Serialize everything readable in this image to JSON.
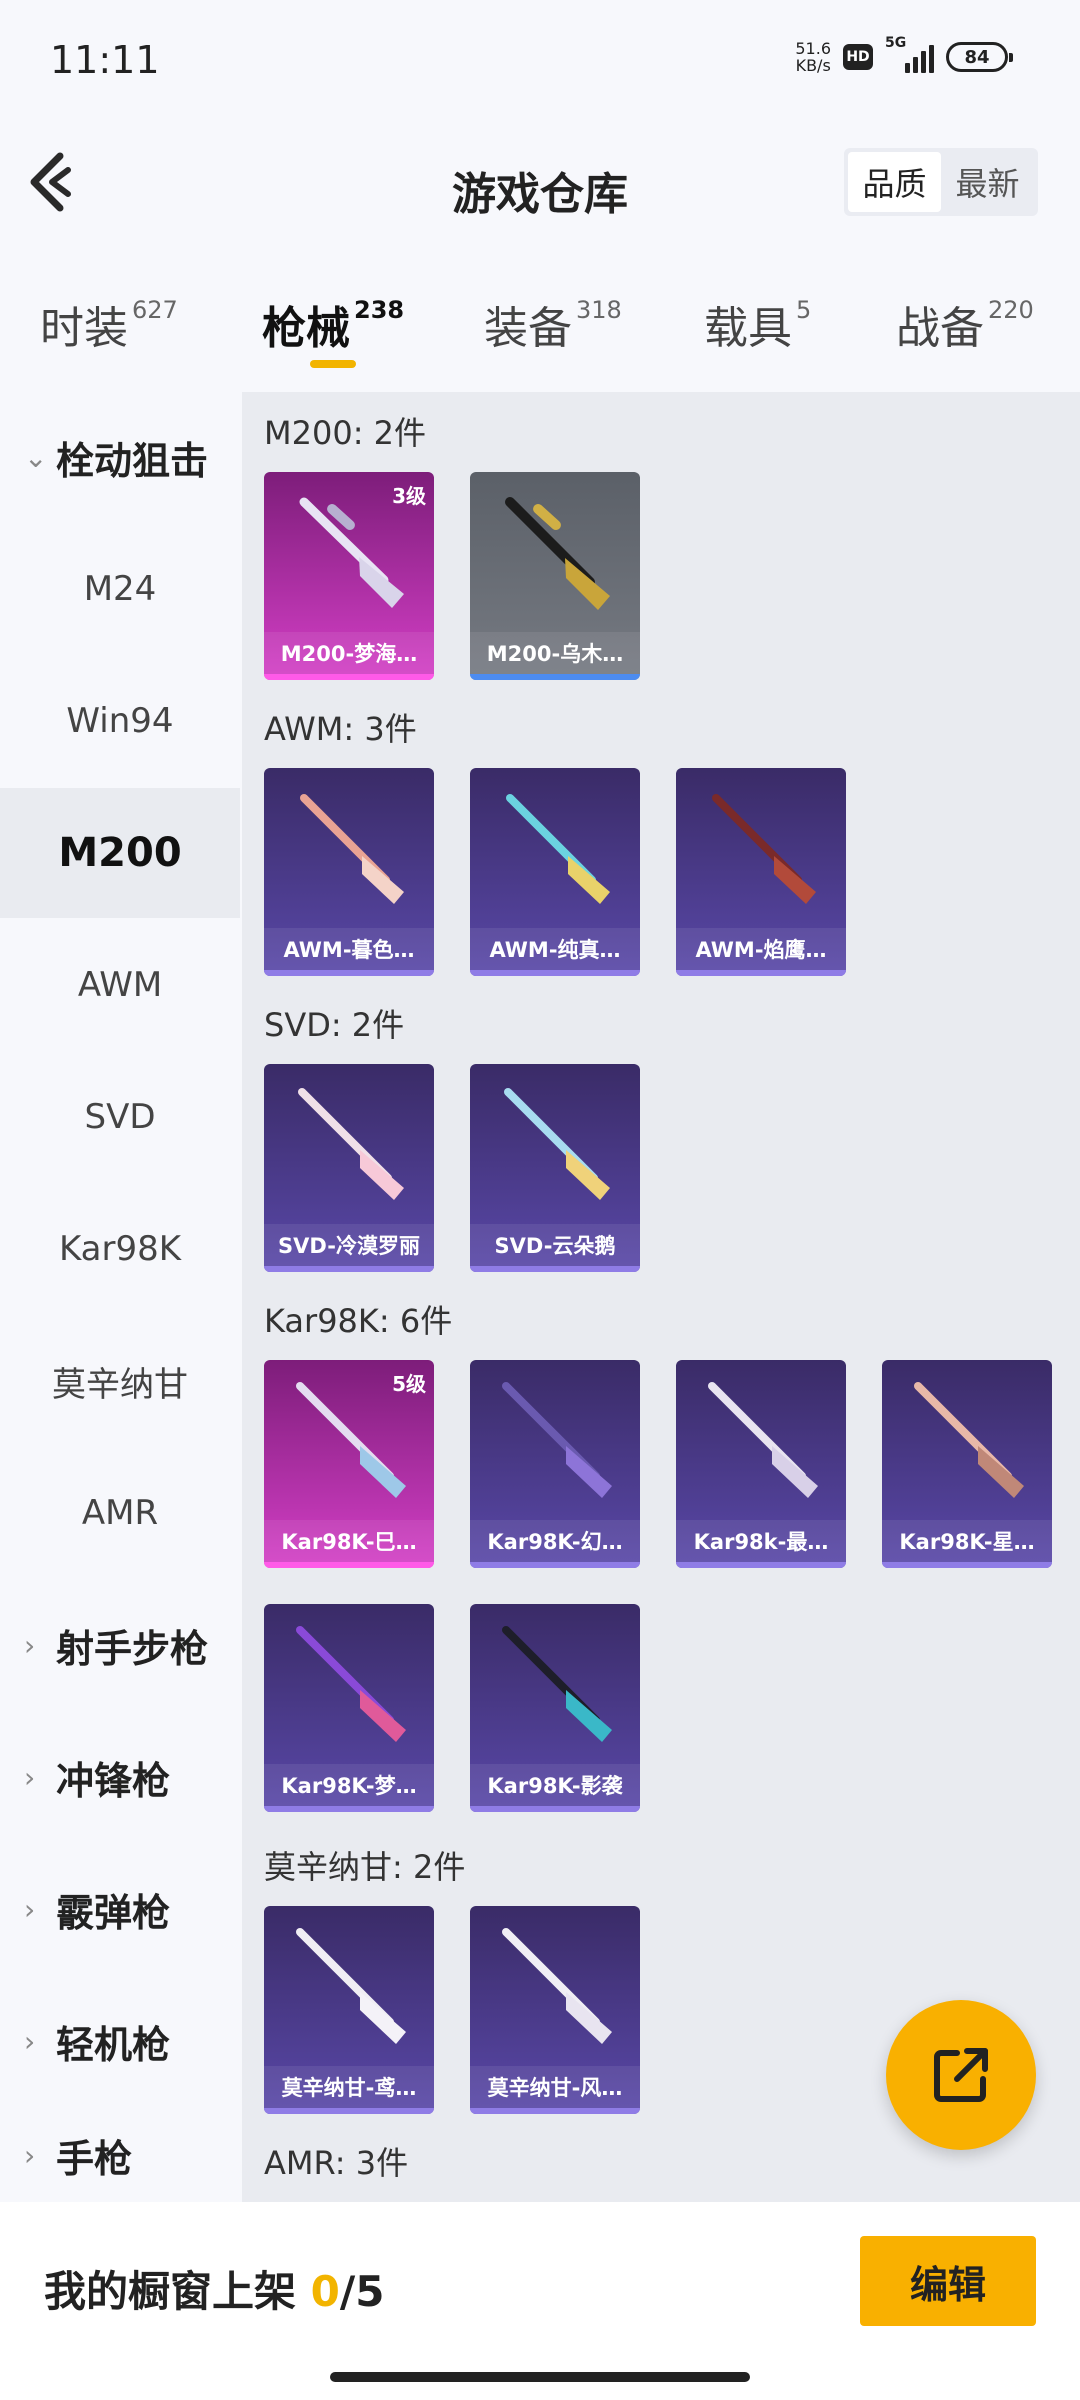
{
  "status_bar": {
    "time": "11:11",
    "net_speed_value": "51.6",
    "net_speed_unit": "KB/s",
    "hd": "HD",
    "network": "5G",
    "battery": "84"
  },
  "header": {
    "title": "游戏仓库",
    "sort_options": [
      "品质",
      "最新"
    ],
    "sort_selected": "品质"
  },
  "tabs": [
    {
      "label": "时装",
      "count": "627"
    },
    {
      "label": "枪械",
      "count": "238",
      "active": true
    },
    {
      "label": "装备",
      "count": "318"
    },
    {
      "label": "载具",
      "count": "5"
    },
    {
      "label": "战备",
      "count": "220"
    }
  ],
  "sidebar": {
    "items": [
      {
        "label": "栓动狙击",
        "type": "group",
        "expanded": true
      },
      {
        "label": "M24"
      },
      {
        "label": "Win94"
      },
      {
        "label": "M200",
        "selected": true
      },
      {
        "label": "AWM"
      },
      {
        "label": "SVD"
      },
      {
        "label": "Kar98K"
      },
      {
        "label": "莫辛纳甘"
      },
      {
        "label": "AMR"
      },
      {
        "label": "射手步枪",
        "type": "group"
      },
      {
        "label": "冲锋枪",
        "type": "group"
      },
      {
        "label": "霰弹枪",
        "type": "group"
      },
      {
        "label": "轻机枪",
        "type": "group"
      },
      {
        "label": "手枪",
        "type": "group"
      }
    ]
  },
  "sections": [
    {
      "title": "M200: 2件",
      "items": [
        {
          "name": "M200-梦海…",
          "level": "3级",
          "rarity": "pink"
        },
        {
          "name": "M200-乌木…",
          "rarity": "gray"
        }
      ]
    },
    {
      "title": "AWM: 3件",
      "items": [
        {
          "name": "AWM-暮色…",
          "rarity": "purple"
        },
        {
          "name": "AWM-纯真…",
          "rarity": "purple"
        },
        {
          "name": "AWM-焰鹰…",
          "rarity": "purple"
        }
      ]
    },
    {
      "title": "SVD: 2件",
      "items": [
        {
          "name": "SVD-冷漠罗丽",
          "rarity": "purple"
        },
        {
          "name": "SVD-云朵鹅",
          "rarity": "purple"
        }
      ]
    },
    {
      "title": "Kar98K: 6件",
      "items": [
        {
          "name": "Kar98K-巳…",
          "level": "5级",
          "rarity": "pink"
        },
        {
          "name": "Kar98K-幻…",
          "rarity": "purple"
        },
        {
          "name": "Kar98k-最…",
          "rarity": "purple"
        },
        {
          "name": "Kar98K-星…",
          "rarity": "purple"
        },
        {
          "name": "Kar98K-梦…",
          "rarity": "purple"
        },
        {
          "name": "Kar98K-影袭",
          "rarity": "purple"
        }
      ]
    },
    {
      "title": "莫辛纳甘: 2件",
      "items": [
        {
          "name": "莫辛纳甘-鸢…",
          "rarity": "purple"
        },
        {
          "name": "莫辛纳甘-风…",
          "rarity": "purple"
        }
      ]
    },
    {
      "title": "AMR: 3件",
      "items": []
    }
  ],
  "bottom": {
    "shelf_label": "我的橱窗上架",
    "shelf_current": "0",
    "shelf_total": "/5",
    "edit_label": "编辑"
  },
  "colors": {
    "accent": "#f9b000",
    "rarity_purple": "#8f7ce6",
    "rarity_pink": "#ff5ae8",
    "rarity_gray": "#4d8cf0"
  }
}
